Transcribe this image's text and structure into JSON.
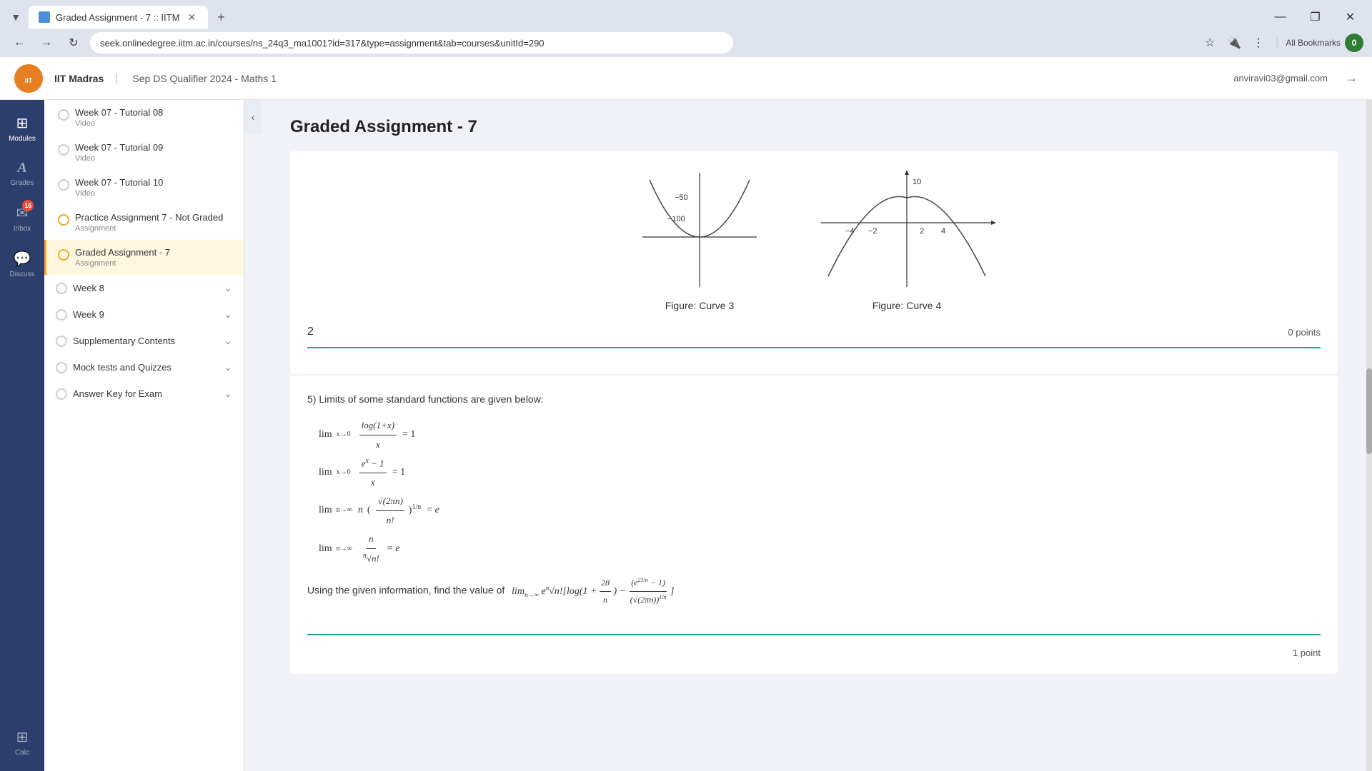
{
  "browser": {
    "tab_title": "Graded Assignment - 7 :: IITM",
    "url": "seek.onlinedegree.iitm.ac.in/courses/ns_24q3_ma1001?id=317&type=assignment&tab=courses&unitId=290",
    "new_tab_label": "+",
    "minimize_label": "—",
    "restore_label": "❐",
    "close_label": "✕"
  },
  "header": {
    "logo_alt": "IIT Madras Logo",
    "institute_name": "IIT Madras",
    "course_title": "Sep DS Qualifier 2024 - Maths 1",
    "user_email": "anviravi03@gmail.com",
    "logout_icon": "→"
  },
  "left_nav": {
    "items": [
      {
        "id": "modules",
        "label": "Modules",
        "icon": "⊞"
      },
      {
        "id": "grades",
        "label": "Grades",
        "icon": "A"
      },
      {
        "id": "inbox",
        "label": "Inbox",
        "icon": "✉",
        "badge": "16"
      },
      {
        "id": "discuss",
        "label": "Discuss",
        "icon": "💬"
      },
      {
        "id": "calc",
        "label": "Calc",
        "icon": "⊞"
      }
    ]
  },
  "sidebar": {
    "items": [
      {
        "id": "w07t08",
        "title": "Week 07 - Tutorial 08",
        "sub": "Video",
        "dot": "empty",
        "active": false
      },
      {
        "id": "w07t09",
        "title": "Week 07 - Tutorial 09",
        "sub": "Video",
        "dot": "empty",
        "active": false
      },
      {
        "id": "w07t10",
        "title": "Week 07 - Tutorial 10",
        "sub": "Video",
        "dot": "empty",
        "active": false
      },
      {
        "id": "pa7",
        "title": "Practice Assignment 7 - Not Graded",
        "sub": "Assignment",
        "dot": "orange",
        "active": false
      },
      {
        "id": "ga7",
        "title": "Graded Assignment - 7",
        "sub": "Assignment",
        "dot": "orange",
        "active": true
      }
    ],
    "sections": [
      {
        "id": "week8",
        "title": "Week 8",
        "expanded": false
      },
      {
        "id": "week9",
        "title": "Week 9",
        "expanded": false
      },
      {
        "id": "supplementary",
        "title": "Supplementary Contents",
        "expanded": false
      },
      {
        "id": "mock",
        "title": "Mock tests and Quizzes",
        "expanded": false
      },
      {
        "id": "answer_key",
        "title": "Answer Key for Exam",
        "expanded": false
      }
    ]
  },
  "content": {
    "page_title": "Graded Assignment - 7",
    "question2": {
      "number": "2",
      "points": "0 points",
      "teal_separator": true
    },
    "question5": {
      "number": "5",
      "intro": "5) Limits of some standard functions are given below:",
      "formulas": [
        "lim_{x→0} log(1+x)/x = 1",
        "lim_{x→0} (e^x - 1)/x = 1",
        "lim_{n→∞} n(√(2πn)/n!)^(1/n) = e",
        "lim_{n→∞} n/∜n! = e"
      ],
      "question_text": "Using the given information, find the value of lim_{n→∞} e∜n! [log(1 + 28/n) - (e^(21/n) - 1) / (√(2πn))^(1/n)]",
      "points": "1 point"
    },
    "figures": {
      "curve3": {
        "caption": "Figure:  Curve 3",
        "labels": {
          "y_neg50": "-50",
          "y_neg100": "-100"
        }
      },
      "curve4": {
        "caption": "Figure:  Curve 4",
        "labels": {
          "x_neg4": "-4",
          "x_neg2": "-2",
          "x2": "2",
          "x4": "4",
          "y10": "10"
        }
      }
    }
  }
}
